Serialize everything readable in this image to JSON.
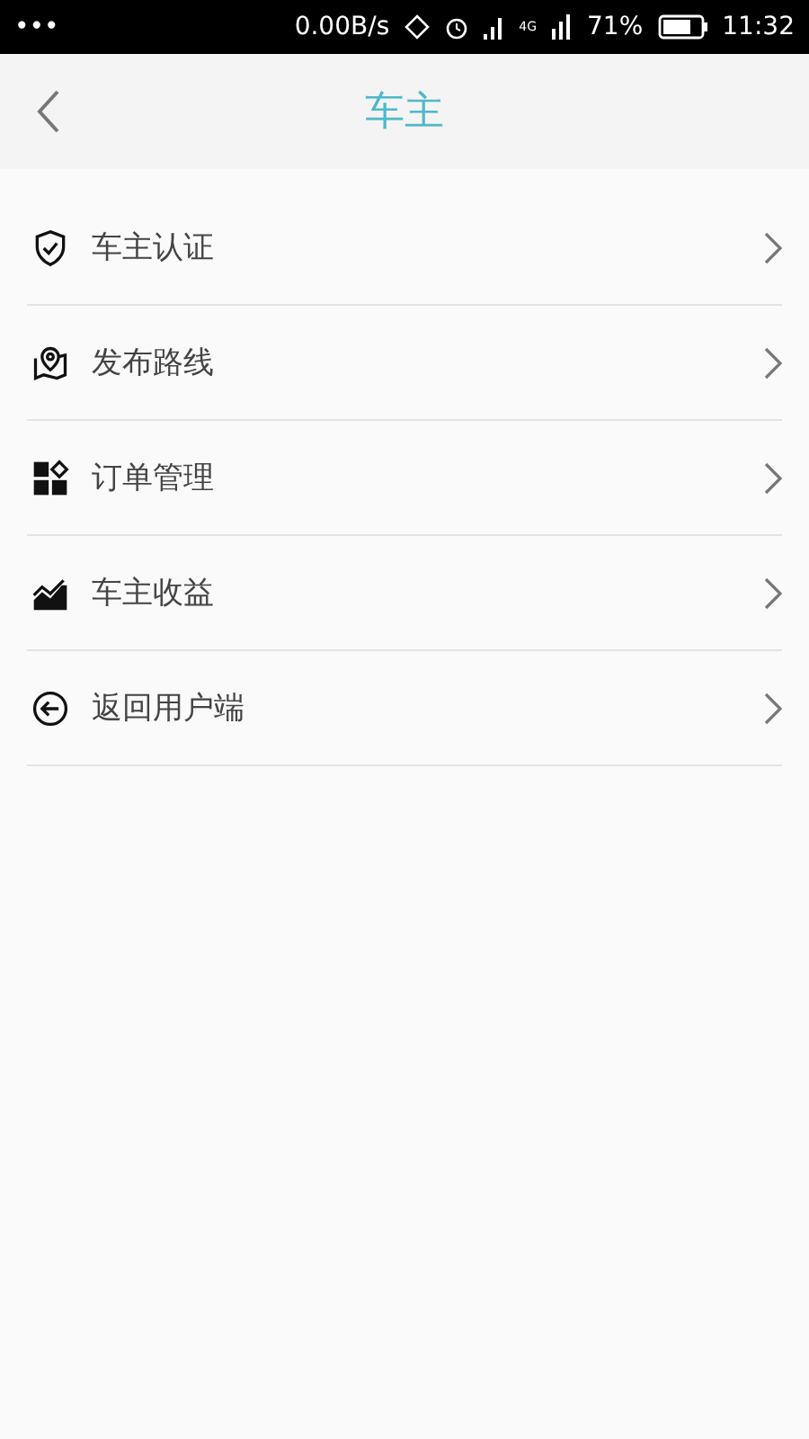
{
  "status_bar": {
    "dots": "•••",
    "speed": "0.00B/s",
    "network": "4G",
    "battery": "71%",
    "time": "11:32"
  },
  "header": {
    "title": "车主"
  },
  "menu": [
    {
      "kind": "shield",
      "label": "车主认证"
    },
    {
      "kind": "map",
      "label": "发布路线"
    },
    {
      "kind": "grid",
      "label": "订单管理"
    },
    {
      "kind": "chart",
      "label": "车主收益"
    },
    {
      "kind": "back",
      "label": "返回用户端"
    }
  ]
}
